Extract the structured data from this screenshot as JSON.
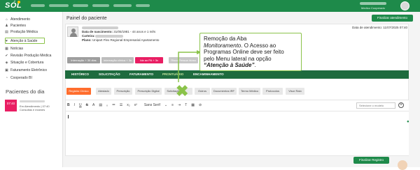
{
  "topbar": {
    "logo": "SÓL",
    "user_role": "Medico Cooperado"
  },
  "sidebar": {
    "items": [
      {
        "label": "Atendimento",
        "icon": "home-icon"
      },
      {
        "label": "Pacientes",
        "icon": "users-icon"
      },
      {
        "label": "Produção Médica",
        "icon": "folder-icon"
      },
      {
        "label": "Atenção à Saúde",
        "icon": "health-icon"
      },
      {
        "label": "Notícias",
        "icon": "news-icon"
      },
      {
        "label": "Revisão Produção Médica",
        "icon": "check-icon"
      },
      {
        "label": "Situação e Cobertura",
        "icon": "shield-icon"
      },
      {
        "label": "Faturamento Eletrônico",
        "icon": "invoice-icon"
      },
      {
        "label": "Cooperado BI",
        "icon": "chart-icon"
      }
    ],
    "today_title": "Pacientes do dia",
    "today_card": {
      "time": "07:40",
      "status": "Em Atendimento | 07:40",
      "sub": "Consultas e exames"
    }
  },
  "main": {
    "page_title": "Painel do paciente",
    "finalize_top": "Finalizar atendimento",
    "date_atendimento": "Data de atendimento: 11/07/2025 07:40",
    "patient": {
      "birth_label": "Data de nascimento:",
      "birth_value": "31/05/1981 - 44 anos e 1 mês",
      "card_label": "Carteira:",
      "plan_label": "Plano:",
      "plan_value": "Unipart Flex Regional Empresarial Apartamento"
    },
    "tags": [
      {
        "label": "Internação + 30 dias",
        "color": "#9e9e9e"
      },
      {
        "label": "Internação clínica + 3x",
        "color": "#bdbdbd"
      },
      {
        "label": "Ida ao PA + 3x",
        "color": "#e91e63"
      },
      {
        "label": "Risco Pessoa Idosa",
        "color": "#c7c7c7"
      }
    ],
    "tabs": [
      "HISTÓRICO",
      "SOLICITAÇÃO",
      "FATURAMENTO",
      "PRONTUÁRIO",
      "ENCAMINHAMENTO"
    ],
    "subtabs": [
      "Registro Clínico",
      "Atestado",
      "Prescrição",
      "Prescrição Digital",
      "Solicitação",
      "Solicitação Digital",
      "Outros",
      "Documentos IRF",
      "Termo Médico",
      "Protocolos",
      "Visor Raio"
    ],
    "editor": {
      "font_name": "Sans Serif",
      "select_placeholder": "Selecione o modelo"
    },
    "finalize_bottom": "Finalizar Registro"
  },
  "callout": {
    "line1": "Remoção da Aba",
    "line2": "Monitoramento",
    "line2_tail": ". O Acesso ao",
    "line3": "Programas Online deve ser feito",
    "line4": "pelo Menu lateral na opção",
    "line5": "“Atenção à Saúde”",
    "line5_tail": "."
  }
}
